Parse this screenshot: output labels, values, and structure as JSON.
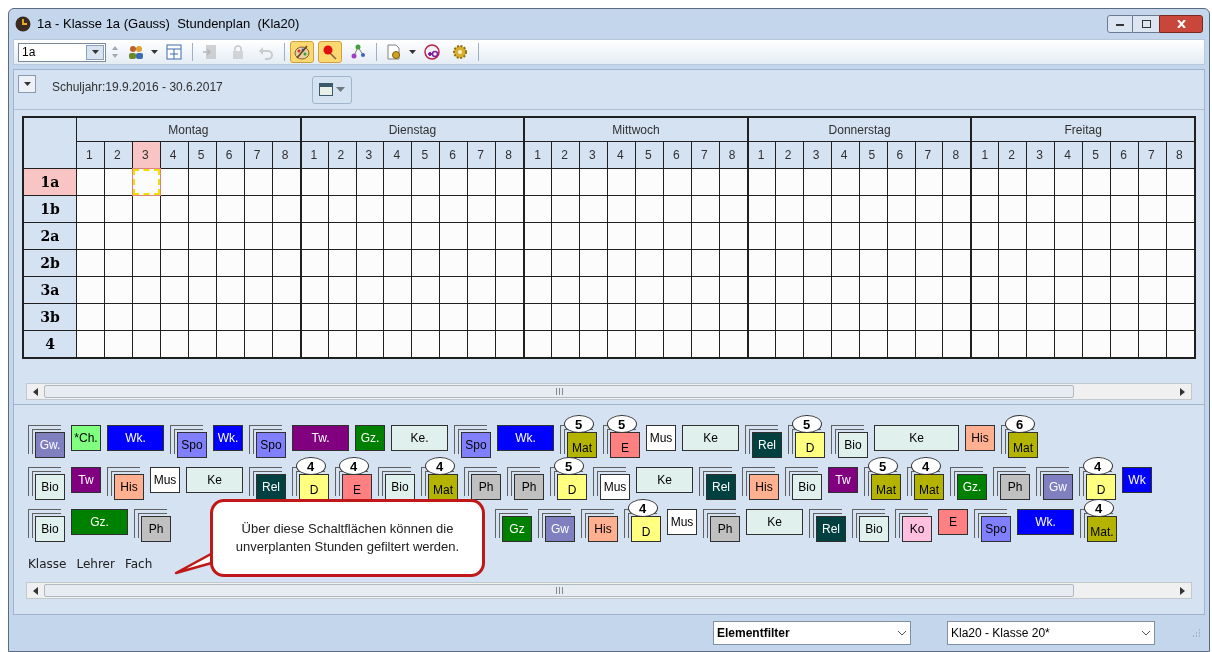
{
  "window": {
    "title": "1a - Klasse 1a (Gauss)  Stundenplan  (Kla20)"
  },
  "toolbar": {
    "class_field": {
      "value": "1a"
    },
    "tools": [
      {
        "kind": "people",
        "pressed": false,
        "disabled": false
      },
      {
        "kind": "grid",
        "pressed": false,
        "disabled": false
      },
      {
        "kind": "door",
        "pressed": false,
        "disabled": true
      },
      {
        "kind": "lock",
        "pressed": false,
        "disabled": true
      },
      {
        "kind": "undo",
        "pressed": false,
        "disabled": true
      },
      {
        "kind": "palette",
        "pressed": true,
        "disabled": false
      },
      {
        "kind": "pin",
        "pressed": true,
        "disabled": false
      },
      {
        "kind": "nodes",
        "pressed": false,
        "disabled": false
      },
      {
        "kind": "docgear",
        "pressed": false,
        "disabled": false
      },
      {
        "kind": "plus5",
        "pressed": false,
        "disabled": false
      },
      {
        "kind": "gear",
        "pressed": false,
        "disabled": false
      }
    ]
  },
  "school_year": "Schuljahr:19.9.2016 - 30.6.2017",
  "timetable": {
    "days": [
      {
        "name": "Montag",
        "periods": [
          {
            "label": "1",
            "selected": false
          },
          {
            "label": "2",
            "selected": false
          },
          {
            "label": "3",
            "selected": true
          },
          {
            "label": "4",
            "selected": false
          },
          {
            "label": "5",
            "selected": false
          },
          {
            "label": "6",
            "selected": false
          },
          {
            "label": "7",
            "selected": false
          },
          {
            "label": "8",
            "selected": false
          }
        ]
      },
      {
        "name": "Dienstag",
        "periods": [
          {
            "label": "1",
            "selected": false
          },
          {
            "label": "2",
            "selected": false
          },
          {
            "label": "3",
            "selected": false
          },
          {
            "label": "4",
            "selected": false
          },
          {
            "label": "5",
            "selected": false
          },
          {
            "label": "6",
            "selected": false
          },
          {
            "label": "7",
            "selected": false
          },
          {
            "label": "8",
            "selected": false
          }
        ]
      },
      {
        "name": "Mittwoch",
        "periods": [
          {
            "label": "1",
            "selected": false
          },
          {
            "label": "2",
            "selected": false
          },
          {
            "label": "3",
            "selected": false
          },
          {
            "label": "4",
            "selected": false
          },
          {
            "label": "5",
            "selected": false
          },
          {
            "label": "6",
            "selected": false
          },
          {
            "label": "7",
            "selected": false
          },
          {
            "label": "8",
            "selected": false
          }
        ]
      },
      {
        "name": "Donnerstag",
        "periods": [
          {
            "label": "1",
            "selected": false
          },
          {
            "label": "2",
            "selected": false
          },
          {
            "label": "3",
            "selected": false
          },
          {
            "label": "4",
            "selected": false
          },
          {
            "label": "5",
            "selected": false
          },
          {
            "label": "6",
            "selected": false
          },
          {
            "label": "7",
            "selected": false
          },
          {
            "label": "8",
            "selected": false
          }
        ]
      },
      {
        "name": "Freitag",
        "periods": [
          {
            "label": "1",
            "selected": false
          },
          {
            "label": "2",
            "selected": false
          },
          {
            "label": "3",
            "selected": false
          },
          {
            "label": "4",
            "selected": false
          },
          {
            "label": "5",
            "selected": false
          },
          {
            "label": "6",
            "selected": false
          },
          {
            "label": "7",
            "selected": false
          },
          {
            "label": "8",
            "selected": false
          }
        ]
      }
    ],
    "classes": [
      {
        "label": "1a",
        "selected": true
      },
      {
        "label": "1b",
        "selected": false
      },
      {
        "label": "2a",
        "selected": false
      },
      {
        "label": "2b",
        "selected": false
      },
      {
        "label": "3a",
        "selected": false
      },
      {
        "label": "3b",
        "selected": false
      },
      {
        "label": "4",
        "selected": false
      }
    ]
  },
  "lesson_rows": [
    {
      "groups": [
        [
          {
            "label": "Gw.",
            "color": "#8080c0",
            "kind": "small",
            "stacked": true
          },
          {
            "label": "*Ch.",
            "color": "#80ff80",
            "kind": "small",
            "stacked": false
          },
          {
            "label": "Wk.",
            "color": "#0000ff",
            "kind": "wide",
            "stacked": false
          },
          {
            "label": "Spo",
            "color": "#8080ff",
            "kind": "small",
            "stacked": true
          },
          {
            "label": "Wk.",
            "color": "#0000ff",
            "kind": "small",
            "stacked": false
          },
          {
            "label": "Spo",
            "color": "#8080ff",
            "kind": "small",
            "stacked": true
          },
          {
            "label": "Tw.",
            "color": "#800080",
            "kind": "wide",
            "stacked": false
          },
          {
            "label": "Gz.",
            "color": "#008000",
            "kind": "small",
            "stacked": false
          },
          {
            "label": "Ke.",
            "color": "#e0f0ec",
            "kind": "wide",
            "stacked": false
          },
          {
            "label": "Spo",
            "color": "#8080ff",
            "kind": "small",
            "stacked": true
          },
          {
            "label": "Wk.",
            "color": "#0000ff",
            "kind": "wide",
            "stacked": false
          },
          {
            "label": "Mat",
            "color": "#b4b400",
            "kind": "small",
            "stacked": true,
            "count": "5"
          },
          {
            "label": "E",
            "color": "#ff8080",
            "kind": "small",
            "stacked": true,
            "count": "5"
          },
          {
            "label": "Mus",
            "color": "#ffffff",
            "kind": "small",
            "stacked": false
          },
          {
            "label": "Ke",
            "color": "#e0f0ec",
            "kind": "wide",
            "stacked": false
          },
          {
            "label": "Rel",
            "color": "#004040",
            "kind": "small",
            "stacked": true
          },
          {
            "label": "D",
            "color": "#ffff80",
            "kind": "small",
            "stacked": true,
            "count": "5"
          },
          {
            "label": "Bio",
            "color": "#e0f0ec",
            "kind": "small",
            "stacked": true
          },
          {
            "label": "Ke",
            "color": "#e0f0ec",
            "kind": "xwide",
            "stacked": false
          },
          {
            "label": "His",
            "color": "#ffb090",
            "kind": "small",
            "stacked": false
          },
          {
            "label": "Mat",
            "color": "#b4b400",
            "kind": "small",
            "stacked": true,
            "count": "6"
          }
        ]
      ]
    },
    {
      "groups": [
        [
          {
            "label": "Bio",
            "color": "#e0f0ec",
            "kind": "small",
            "stacked": true
          },
          {
            "label": "Tw",
            "color": "#800080",
            "kind": "small",
            "stacked": false
          },
          {
            "label": "His",
            "color": "#ffb090",
            "kind": "small",
            "stacked": true
          },
          {
            "label": "Mus",
            "color": "#ffffff",
            "kind": "small",
            "stacked": false
          },
          {
            "label": "Ke",
            "color": "#e0f0ec",
            "kind": "wide",
            "stacked": false
          },
          {
            "label": "Rel",
            "color": "#004040",
            "kind": "small",
            "stacked": true
          },
          {
            "label": "D",
            "color": "#ffff80",
            "kind": "small",
            "stacked": true,
            "count": "4"
          },
          {
            "label": "E",
            "color": "#ff8080",
            "kind": "small",
            "stacked": true,
            "count": "4"
          },
          {
            "label": "Bio",
            "color": "#e0f0ec",
            "kind": "small",
            "stacked": true
          },
          {
            "label": "Mat",
            "color": "#b4b400",
            "kind": "small",
            "stacked": true,
            "count": "4"
          },
          {
            "label": "Ph",
            "color": "#c0c0c0",
            "kind": "small",
            "stacked": true
          },
          {
            "label": "Ph",
            "color": "#c0c0c0",
            "kind": "small",
            "stacked": true
          },
          {
            "label": "D",
            "color": "#ffff80",
            "kind": "small",
            "stacked": true,
            "count": "5"
          },
          {
            "label": "Mus",
            "color": "#ffffff",
            "kind": "small",
            "stacked": true
          },
          {
            "label": "Ke",
            "color": "#e0f0ec",
            "kind": "wide",
            "stacked": false
          },
          {
            "label": "Rel",
            "color": "#004040",
            "kind": "small",
            "stacked": true
          },
          {
            "label": "His",
            "color": "#ffb090",
            "kind": "small",
            "stacked": true
          },
          {
            "label": "Bio",
            "color": "#e0f0ec",
            "kind": "small",
            "stacked": true
          },
          {
            "label": "Tw",
            "color": "#800080",
            "kind": "small",
            "stacked": false
          },
          {
            "label": "Mat",
            "color": "#b4b400",
            "kind": "small",
            "stacked": true,
            "count": "5"
          },
          {
            "label": "Mat",
            "color": "#b4b400",
            "kind": "small",
            "stacked": true,
            "count": "4"
          },
          {
            "label": "Gz.",
            "color": "#008000",
            "kind": "small",
            "stacked": true
          },
          {
            "label": "Ph",
            "color": "#c0c0c0",
            "kind": "small",
            "stacked": true
          },
          {
            "label": "Gw",
            "color": "#8080c0",
            "kind": "small",
            "stacked": true
          },
          {
            "label": "D",
            "color": "#ffff80",
            "kind": "small",
            "stacked": true,
            "count": "4"
          },
          {
            "label": "Wk",
            "color": "#0000ff",
            "kind": "small",
            "stacked": false
          }
        ]
      ]
    },
    {
      "groups": [
        [
          {
            "label": "Bio",
            "color": "#e0f0ec",
            "kind": "small",
            "stacked": true
          },
          {
            "label": "Gz.",
            "color": "#008000",
            "kind": "wide",
            "stacked": false
          },
          {
            "label": "Ph",
            "color": "#c0c0c0",
            "kind": "small",
            "stacked": true
          }
        ],
        [
          {
            "label": "Gz",
            "color": "#008000",
            "kind": "small",
            "stacked": true
          },
          {
            "label": "Gw",
            "color": "#8080c0",
            "kind": "small",
            "stacked": true
          },
          {
            "label": "His",
            "color": "#ffb090",
            "kind": "small",
            "stacked": true
          },
          {
            "label": "D",
            "color": "#ffff80",
            "kind": "small",
            "stacked": true,
            "count": "4"
          },
          {
            "label": "Mus",
            "color": "#ffffff",
            "kind": "small",
            "stacked": false
          },
          {
            "label": "Ph",
            "color": "#c0c0c0",
            "kind": "small",
            "stacked": true
          },
          {
            "label": "Ke",
            "color": "#e0f0ec",
            "kind": "wide",
            "stacked": false
          },
          {
            "label": "Rel",
            "color": "#004040",
            "kind": "small",
            "stacked": true
          },
          {
            "label": "Bio",
            "color": "#e0f0ec",
            "kind": "small",
            "stacked": true
          },
          {
            "label": "Ko",
            "color": "#ffc0e0",
            "kind": "small",
            "stacked": true
          },
          {
            "label": "E",
            "color": "#ff8080",
            "kind": "small",
            "stacked": false
          },
          {
            "label": "Spo",
            "color": "#8080ff",
            "kind": "small",
            "stacked": true
          },
          {
            "label": "Wk.",
            "color": "#0000ff",
            "kind": "wide",
            "stacked": false
          },
          {
            "label": "Mat.",
            "color": "#b4b400",
            "kind": "small",
            "stacked": true,
            "count": "4"
          }
        ]
      ]
    }
  ],
  "filter_buttons": [
    "Klasse",
    "Lehrer",
    "Fach"
  ],
  "callout": "Über diese Schaltflächen können die unverplanten Stunden gefiltert werden.",
  "status_bar": {
    "filter_select": "Elementfilter",
    "class_select": "Kla20 - Klasse 20*"
  }
}
